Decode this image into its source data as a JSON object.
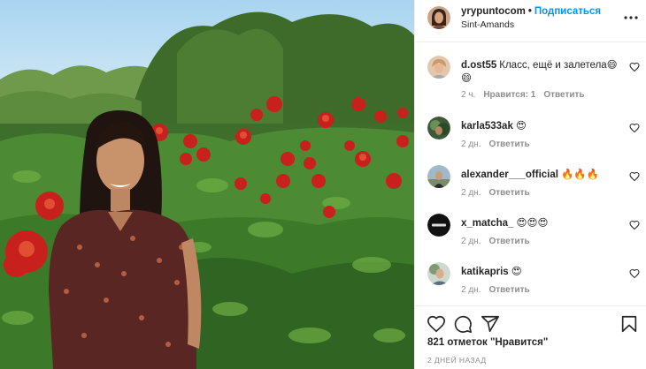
{
  "post": {
    "username": "yrypuntocom",
    "dot": "•",
    "follow_label": "Подписаться",
    "location": "Sint-Amands",
    "more_icon": "more-horizontal-icon"
  },
  "comments": [
    {
      "username": "d.ost55",
      "text": "Класс, ещё и залетела😄😄",
      "time": "2 ч.",
      "likes": "Нравится: 1",
      "reply": "Ответить"
    },
    {
      "username": "karla533ak",
      "text": "😍",
      "time": "2 дн.",
      "reply": "Ответить"
    },
    {
      "username": "alexander___official",
      "text": "🔥🔥🔥",
      "time": "2 дн.",
      "reply": "Ответить"
    },
    {
      "username": "x_matcha_",
      "text": "😍😍😍",
      "time": "2 дн.",
      "reply": "Ответить"
    },
    {
      "username": "katikapris",
      "text": "😍",
      "time": "2 дн.",
      "reply": "Ответить"
    }
  ],
  "actions": {
    "likes_text": "821 отметок \"Нравится\"",
    "date_text": "2 ДНЕЙ НАЗАД",
    "icons": [
      "heart-icon",
      "comment-icon",
      "share-icon",
      "bookmark-icon"
    ]
  },
  "colors": {
    "follow": "#0095f6",
    "secondary_text": "#8e8e8e",
    "border": "#efefef"
  }
}
